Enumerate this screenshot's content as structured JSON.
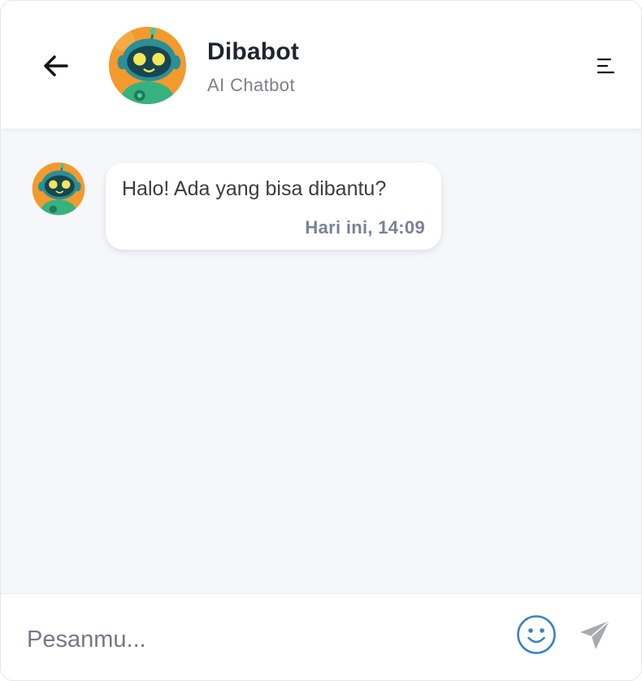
{
  "header": {
    "back_icon": "arrow-left-icon",
    "avatar_icon": "robot-avatar-icon",
    "title": "Dibabot",
    "subtitle": "AI Chatbot",
    "menu_icon": "menu-lines-icon"
  },
  "messages": [
    {
      "sender": "bot",
      "avatar_icon": "robot-avatar-icon",
      "text": "Halo! Ada yang bisa dibantu?",
      "timestamp": "Hari ini, 14:09"
    }
  ],
  "composer": {
    "placeholder": "Pesanmu...",
    "value": "",
    "emoji_icon": "smiley-icon",
    "send_icon": "paper-plane-icon"
  },
  "colors": {
    "accent": "#3b82c4",
    "background": "#f6f7fb",
    "title": "#1e2430",
    "subtitle": "#7c8088",
    "timestamp": "#7a8294",
    "send_disabled": "#a6abb3",
    "avatar_bg": "#f29a2e",
    "robot_body": "#2aa58a"
  }
}
